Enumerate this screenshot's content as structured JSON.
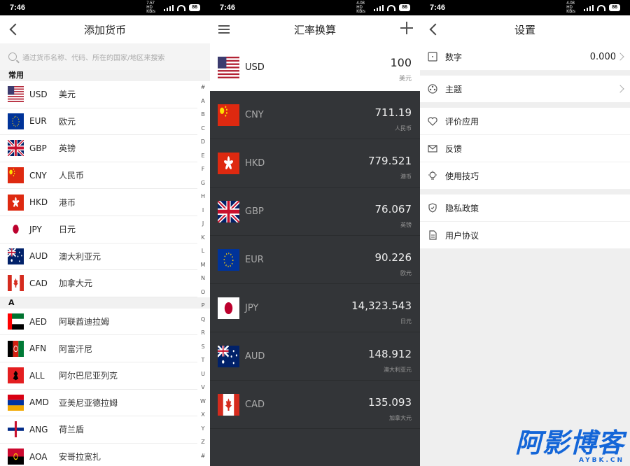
{
  "status": {
    "time_left": "7:46",
    "time_mid": "7:46",
    "time_right": "7:46",
    "speed_left": "7.57 HD KB/s",
    "speed_mid": "4.08 HD KB/s",
    "speed_right": "4.08 HD KB/s",
    "battery": "86"
  },
  "add_currency": {
    "title": "添加货币",
    "search_placeholder": "通过货币名称、代码、所在的国家/地区来搜索",
    "section_common": "常用",
    "section_a": "A",
    "common": [
      {
        "code": "USD",
        "name": "美元",
        "flag": "us"
      },
      {
        "code": "EUR",
        "name": "欧元",
        "flag": "eu"
      },
      {
        "code": "GBP",
        "name": "英镑",
        "flag": "gb"
      },
      {
        "code": "CNY",
        "name": "人民币",
        "flag": "cn"
      },
      {
        "code": "HKD",
        "name": "港币",
        "flag": "hk"
      },
      {
        "code": "JPY",
        "name": "日元",
        "flag": "jp"
      },
      {
        "code": "AUD",
        "name": "澳大利亚元",
        "flag": "au"
      },
      {
        "code": "CAD",
        "name": "加拿大元",
        "flag": "ca"
      }
    ],
    "a_list": [
      {
        "code": "AED",
        "name": "阿联酋迪拉姆",
        "flag": "ae"
      },
      {
        "code": "AFN",
        "name": "阿富汗尼",
        "flag": "af"
      },
      {
        "code": "ALL",
        "name": "阿尔巴尼亚列克",
        "flag": "al"
      },
      {
        "code": "AMD",
        "name": "亚美尼亚德拉姆",
        "flag": "am"
      },
      {
        "code": "ANG",
        "name": "荷兰盾",
        "flag": "an"
      },
      {
        "code": "AOA",
        "name": "安哥拉宽扎",
        "flag": "ao"
      }
    ],
    "alphabet": [
      "#",
      "A",
      "B",
      "C",
      "D",
      "E",
      "F",
      "G",
      "H",
      "I",
      "J",
      "K",
      "L",
      "M",
      "N",
      "O",
      "P",
      "Q",
      "R",
      "S",
      "T",
      "U",
      "V",
      "W",
      "X",
      "Y",
      "Z",
      "#"
    ]
  },
  "converter": {
    "title": "汇率换算",
    "base": {
      "code": "USD",
      "value": "100",
      "unit": "美元",
      "flag": "us"
    },
    "rates": [
      {
        "code": "CNY",
        "value": "711.19",
        "unit": "人民币",
        "flag": "cn"
      },
      {
        "code": "HKD",
        "value": "779.521",
        "unit": "港币",
        "flag": "hk"
      },
      {
        "code": "GBP",
        "value": "76.067",
        "unit": "英镑",
        "flag": "gb"
      },
      {
        "code": "EUR",
        "value": "90.226",
        "unit": "欧元",
        "flag": "eu"
      },
      {
        "code": "JPY",
        "value": "14,323.543",
        "unit": "日元",
        "flag": "jp"
      },
      {
        "code": "AUD",
        "value": "148.912",
        "unit": "澳大利亚元",
        "flag": "au"
      },
      {
        "code": "CAD",
        "value": "135.093",
        "unit": "加拿大元",
        "flag": "ca"
      }
    ]
  },
  "settings": {
    "title": "设置",
    "number_label": "数字",
    "number_value": "0.000",
    "theme_label": "主题",
    "rate_label": "评价应用",
    "feedback_label": "反馈",
    "tips_label": "使用技巧",
    "privacy_label": "隐私政策",
    "agreement_label": "用户协议"
  },
  "watermark": {
    "big": "阿影博客",
    "small": "AYBK.CN"
  }
}
